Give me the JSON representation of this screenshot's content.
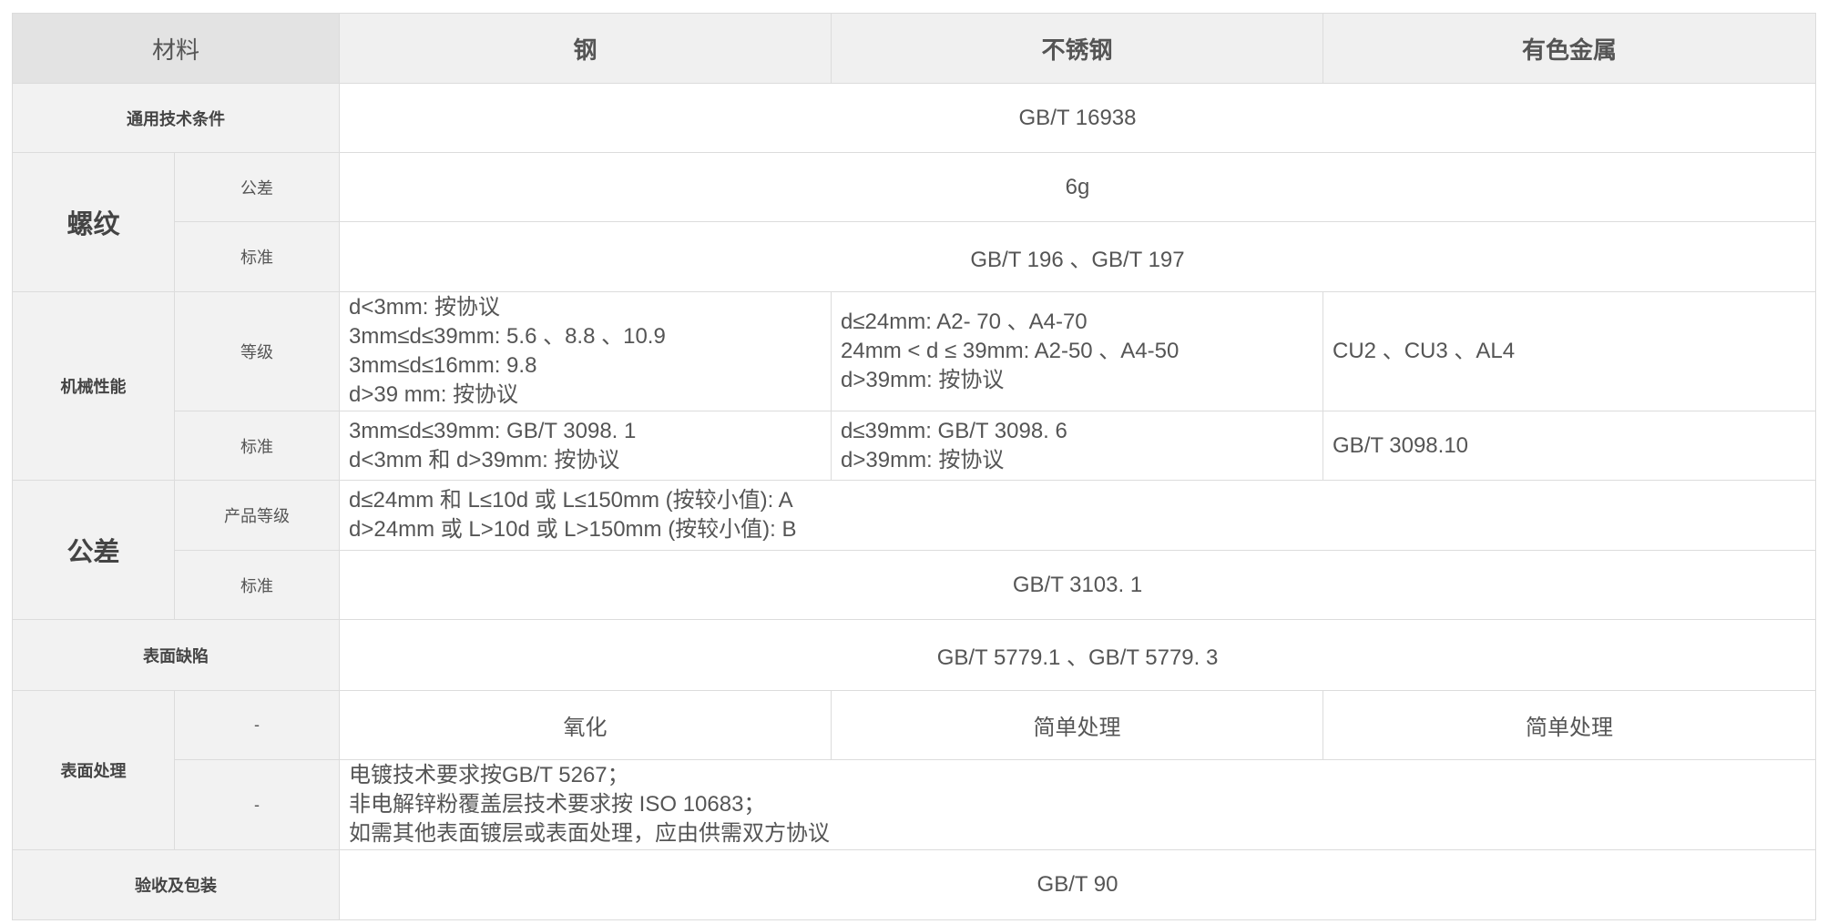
{
  "header": {
    "material": "材料",
    "steel": "钢",
    "stainless": "不锈钢",
    "nonferrous": "有色金属"
  },
  "general": {
    "label": "通用技术条件",
    "value": "GB/T 16938"
  },
  "thread": {
    "label": "螺纹",
    "tolerance_label": "公差",
    "tolerance_value": "6g",
    "standard_label": "标准",
    "standard_value": "GB/T 196 、GB/T 197"
  },
  "mechanical": {
    "label": "机械性能",
    "grade_label": "等级",
    "grade_steel": [
      "d<3mm: 按协议",
      "3mm≤d≤39mm: 5.6 、8.8 、10.9",
      "3mm≤d≤16mm: 9.8",
      "d>39 mm: 按协议"
    ],
    "grade_stainless": [
      "d≤24mm: A2- 70 、A4-70",
      "24mm < d ≤ 39mm: A2-50 、A4-50",
      "d>39mm: 按协议"
    ],
    "grade_nonferrous": "CU2 、CU3 、AL4",
    "standard_label": "标准",
    "standard_steel": [
      "3mm≤d≤39mm: GB/T 3098. 1",
      "d<3mm 和 d>39mm: 按协议"
    ],
    "standard_stainless": [
      "d≤39mm: GB/T 3098. 6",
      "d>39mm: 按协议"
    ],
    "standard_nonferrous": "GB/T 3098.10"
  },
  "tolerance": {
    "label": "公差",
    "product_grade_label": "产品等级",
    "product_grade_value": [
      "d≤24mm 和 L≤10d 或 L≤150mm (按较小值): A",
      "d>24mm 或 L>10d 或 L>150mm (按较小值): B"
    ],
    "standard_label": "标准",
    "standard_value": "GB/T 3103. 1"
  },
  "surface_defects": {
    "label": "表面缺陷",
    "value": "GB/T 5779.1 、GB/T 5779. 3"
  },
  "surface_treatment": {
    "label": "表面处理",
    "row1_label": "-",
    "row1_steel": "氧化",
    "row1_stainless": "简单处理",
    "row1_nonferrous": "简单处理",
    "row2_label": "-",
    "row2_value": [
      "电镀技术要求按GB/T 5267；",
      "非电解锌粉覆盖层技术要求按 ISO 10683；",
      "如需其他表面镀层或表面处理，应由供需双方协议"
    ]
  },
  "acceptance": {
    "label": "验收及包装",
    "value": "GB/T 90"
  }
}
